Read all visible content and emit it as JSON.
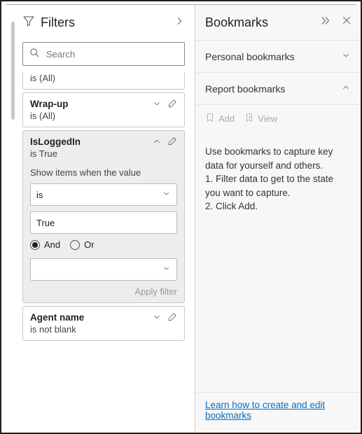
{
  "filters": {
    "title": "Filters",
    "search_placeholder": "Search",
    "card0_status": "is (All)",
    "card1_title": "Wrap-up",
    "card1_status": "is (All)",
    "card2_title": "IsLoggedIn",
    "card2_status": "is True",
    "card2_desc": "Show items when the value",
    "card2_op": "is",
    "card2_val": "True",
    "and_label": "And",
    "or_label": "Or",
    "apply": "Apply filter",
    "card3_title": "Agent name",
    "card3_status": "is not blank"
  },
  "bookmarks": {
    "title": "Bookmarks",
    "personal": "Personal bookmarks",
    "report": "Report bookmarks",
    "add": "Add",
    "view": "View",
    "help": "Use bookmarks to capture key data for yourself and others.\n1. Filter data to get to the state you want to capture.\n2. Click Add.",
    "link": "Learn how to create and edit bookmarks"
  }
}
